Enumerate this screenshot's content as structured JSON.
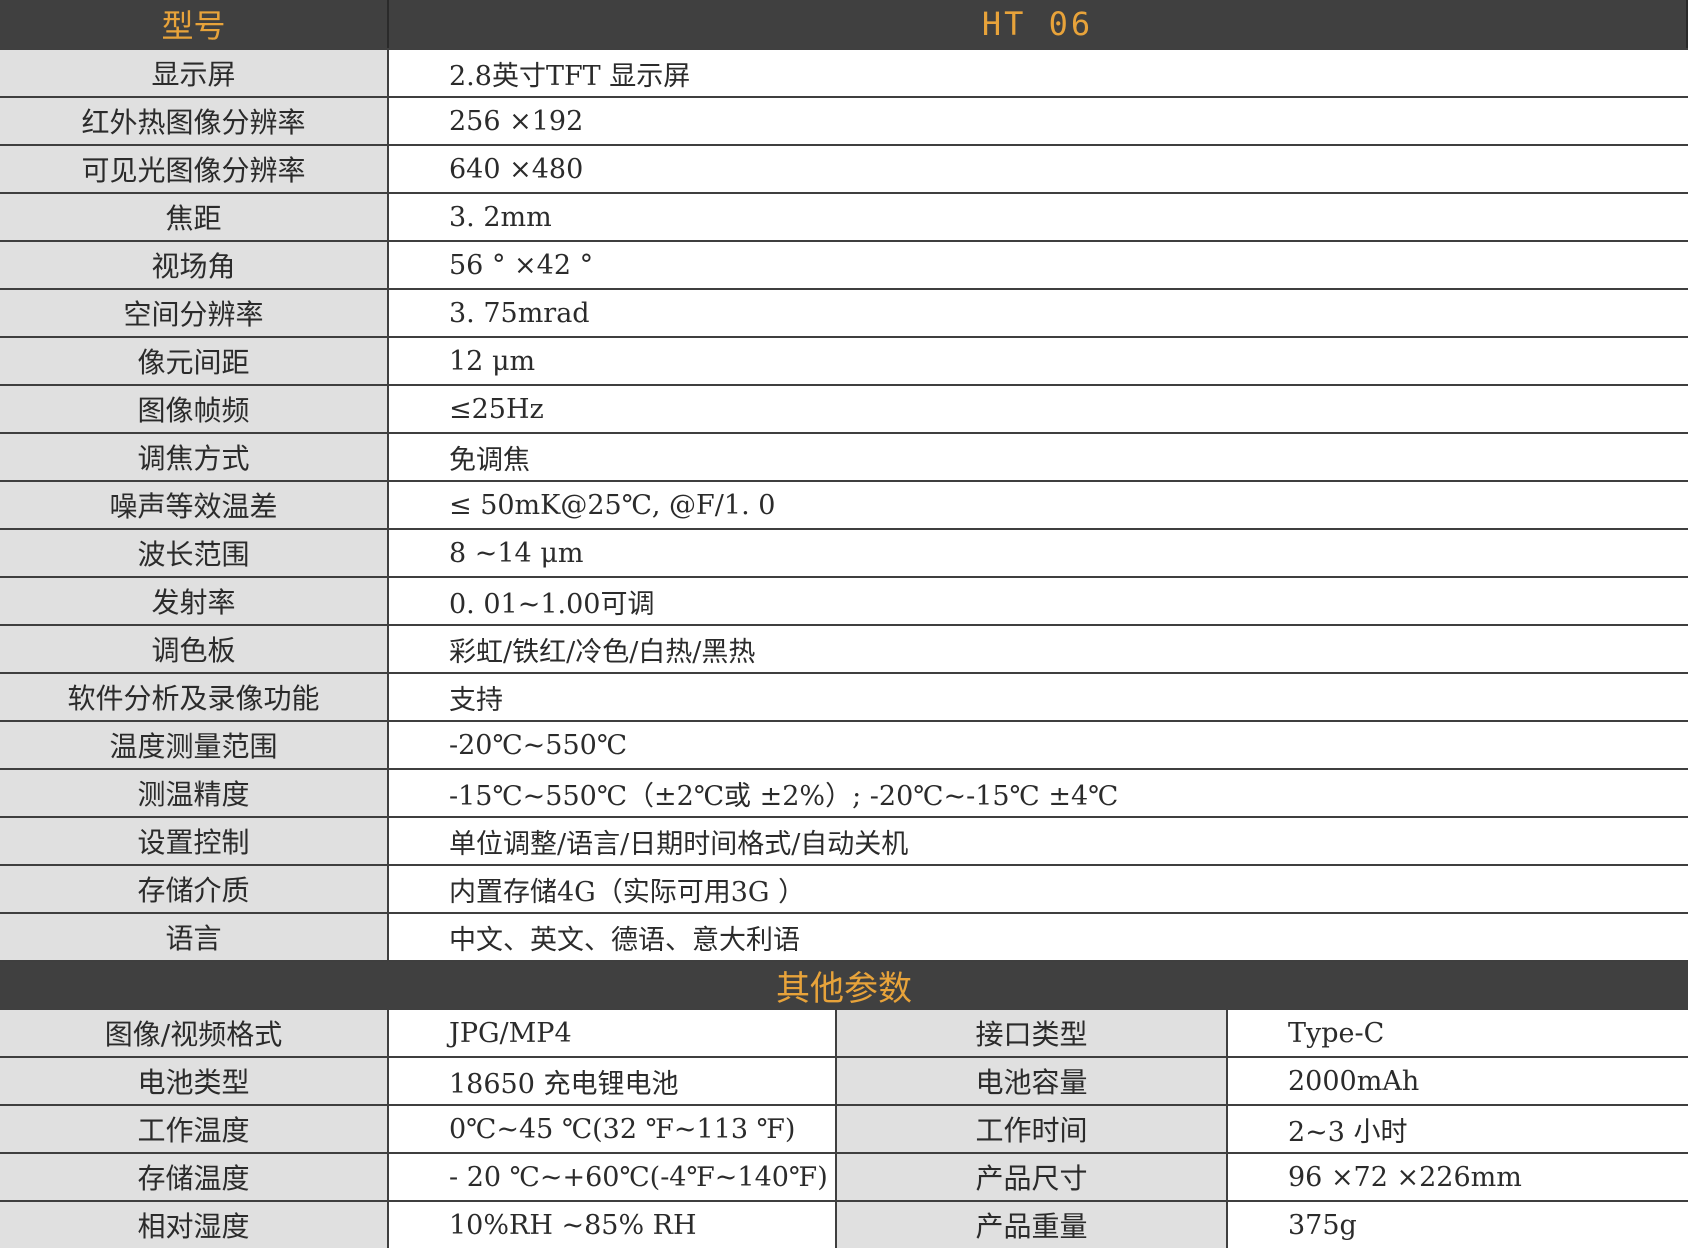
{
  "header": {
    "model_label": "型号",
    "model_value": "HT 06"
  },
  "specs": [
    {
      "label": "显示屏",
      "value": "2.8英寸TFT 显示屏"
    },
    {
      "label": "红外热图像分辨率",
      "value": "256 ×192"
    },
    {
      "label": "可见光图像分辨率",
      "value": "640 ×480"
    },
    {
      "label": "焦距",
      "value": "3. 2mm"
    },
    {
      "label": "视场角",
      "value": "56 ° ×42 °"
    },
    {
      "label": "空间分辨率",
      "value": "3. 75mrad"
    },
    {
      "label": "像元间距",
      "value": "12 μm"
    },
    {
      "label": "图像帧频",
      "value": "≤25Hz"
    },
    {
      "label": "调焦方式",
      "value": "免调焦"
    },
    {
      "label": "噪声等效温差",
      "value": "≤ 50mK@25℃, @F/1. 0"
    },
    {
      "label": "波长范围",
      "value": "8 ~14 μm"
    },
    {
      "label": "发射率",
      "value": "0. 01~1.00可调"
    },
    {
      "label": "调色板",
      "value": "彩虹/铁红/冷色/白热/黑热"
    },
    {
      "label": "软件分析及录像功能",
      "value": "支持"
    },
    {
      "label": "温度测量范围",
      "value": "-20℃~550℃"
    },
    {
      "label": "测温精度",
      "value": "-15℃~550℃（±2℃或 ±2%）; -20℃~-15℃ ±4℃"
    },
    {
      "label": "设置控制",
      "value": "单位调整/语言/日期时间格式/自动关机"
    },
    {
      "label": "存储介质",
      "value": "内置存储4G（实际可用3G ）"
    },
    {
      "label": "语言",
      "value": "中文、英文、德语、意大利语"
    }
  ],
  "other_section": {
    "title": "其他参数",
    "rows": [
      {
        "label1": "图像/视频格式",
        "value1": "JPG/MP4",
        "label2": "接口类型",
        "value2": "Type-C"
      },
      {
        "label1": "电池类型",
        "value1": "18650 充电锂电池",
        "label2": "电池容量",
        "value2": "2000mAh"
      },
      {
        "label1": "工作温度",
        "value1": "0℃~45 ℃(32 ℉~113 ℉)",
        "label2": "工作时间",
        "value2": "2~3 小时"
      },
      {
        "label1": "存储温度",
        "value1": "- 20 ℃~+60℃(-4℉~140℉)",
        "label2": "产品尺寸",
        "value2": "96 ×72 ×226mm"
      },
      {
        "label1": "相对湿度",
        "value1": "10%RH ~85% RH",
        "label2": "产品重量",
        "value2": "375g"
      }
    ]
  },
  "colors": {
    "header_bg": "#404040",
    "header_text": "#e8a33a",
    "label_bg": "#e0e0e0",
    "border": "#3f3f3f"
  }
}
